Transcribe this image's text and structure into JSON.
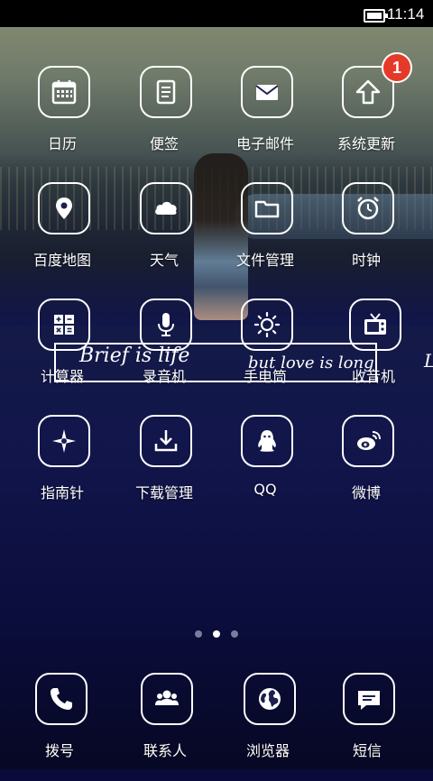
{
  "status_bar": {
    "time": "11:14"
  },
  "apps": [
    {
      "label": "日历",
      "icon": "calendar-icon"
    },
    {
      "label": "便签",
      "icon": "notes-icon"
    },
    {
      "label": "电子邮件",
      "icon": "mail-icon"
    },
    {
      "label": "系统更新",
      "icon": "update-arrow-icon",
      "badge": "1"
    },
    {
      "label": "百度地图",
      "icon": "map-pin-icon"
    },
    {
      "label": "天气",
      "icon": "cloud-icon"
    },
    {
      "label": "文件管理",
      "icon": "folder-icon"
    },
    {
      "label": "时钟",
      "icon": "alarm-clock-icon"
    },
    {
      "label": "计算器",
      "icon": "calculator-icon"
    },
    {
      "label": "录音机",
      "icon": "microphone-icon"
    },
    {
      "label": "手电筒",
      "icon": "sun-icon"
    },
    {
      "label": "收音机",
      "icon": "radio-tv-icon"
    },
    {
      "label": "指南针",
      "icon": "compass-icon"
    },
    {
      "label": "下载管理",
      "icon": "download-icon"
    },
    {
      "label": "QQ",
      "icon": "penguin-icon"
    },
    {
      "label": "微博",
      "icon": "weibo-eye-icon"
    }
  ],
  "wallpaper_text": {
    "line1": "Brief is life",
    "line2": "but love is long",
    "cut": "L"
  },
  "page_indicator": {
    "count": 3,
    "active": 1
  },
  "dock": [
    {
      "label": "拨号",
      "icon": "phone-icon"
    },
    {
      "label": "联系人",
      "icon": "contacts-icon"
    },
    {
      "label": "浏览器",
      "icon": "globe-icon"
    },
    {
      "label": "短信",
      "icon": "message-icon"
    }
  ],
  "colors": {
    "badge": "#e53a2a",
    "icon_outline": "#ffffff",
    "background_bottom": "#0a0b3a"
  }
}
